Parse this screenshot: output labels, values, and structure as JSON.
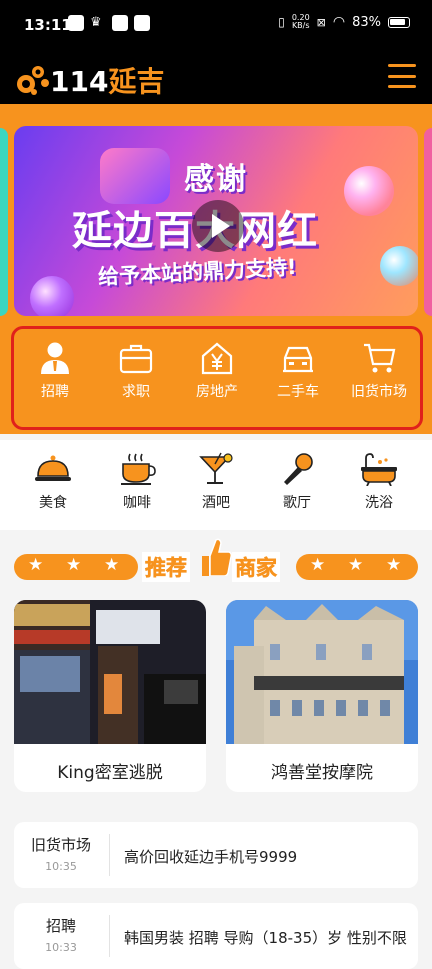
{
  "status_bar": {
    "time": "13:11",
    "net_speed_value": "0.20",
    "net_speed_unit": "KB/s",
    "battery": "83%"
  },
  "header": {
    "logo_number": "114",
    "logo_city": "延吉"
  },
  "banner": {
    "line1": "感谢",
    "line2": "延边百大网红",
    "line3": "给予本站的鼎力支持!"
  },
  "categories_primary": [
    {
      "label": "招聘",
      "icon": "person-icon"
    },
    {
      "label": "求职",
      "icon": "briefcase-icon"
    },
    {
      "label": "房地产",
      "icon": "house-yen-icon"
    },
    {
      "label": "二手车",
      "icon": "car-icon"
    },
    {
      "label": "旧货市场",
      "icon": "cart-icon"
    }
  ],
  "categories_secondary": [
    {
      "label": "美食",
      "icon": "food-cloche-icon"
    },
    {
      "label": "咖啡",
      "icon": "coffee-cup-icon"
    },
    {
      "label": "酒吧",
      "icon": "cocktail-icon"
    },
    {
      "label": "歌厅",
      "icon": "microphone-icon"
    },
    {
      "label": "洗浴",
      "icon": "bathtub-icon"
    }
  ],
  "recommended": {
    "title_left": "推荐",
    "title_right": "商家"
  },
  "merchants": [
    {
      "name": "King密室逃脱"
    },
    {
      "name": "鸿善堂按摩院"
    }
  ],
  "news": [
    {
      "tag": "旧货市场",
      "time": "10:35",
      "text": "高价回收延边手机号9999"
    },
    {
      "tag": "招聘",
      "time": "10:33",
      "text": "韩国男装 招聘 导购（18-35）岁 性别不限"
    }
  ],
  "colors": {
    "accent": "#f7931e",
    "highlight": "#e0211b"
  }
}
